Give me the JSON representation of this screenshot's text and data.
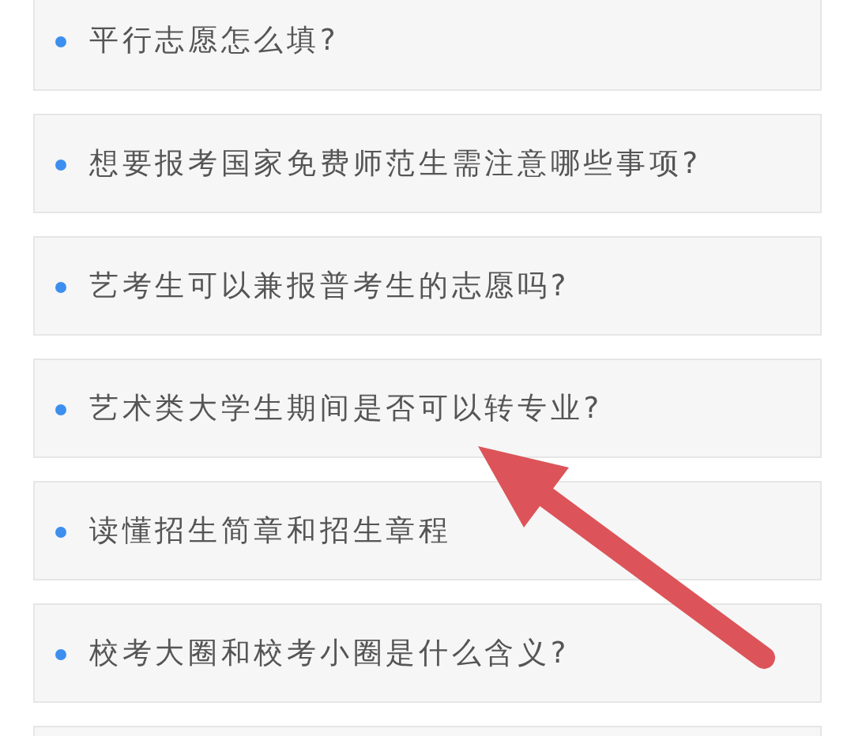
{
  "questions": [
    {
      "kind": "question",
      "text": "平行志愿怎么填?"
    },
    {
      "kind": "question",
      "text": "想要报考国家免费师范生需注意哪些事项?"
    },
    {
      "kind": "question",
      "text": "艺考生可以兼报普考生的志愿吗?"
    },
    {
      "kind": "question",
      "text": "艺术类大学生期间是否可以转专业?"
    },
    {
      "kind": "question",
      "text": "读懂招生简章和招生章程"
    },
    {
      "kind": "question",
      "text": "校考大圈和校考小圈是什么含义?"
    },
    {
      "kind": "cut_off"
    }
  ],
  "annotations": [
    {
      "kind": "arrow"
    }
  ]
}
